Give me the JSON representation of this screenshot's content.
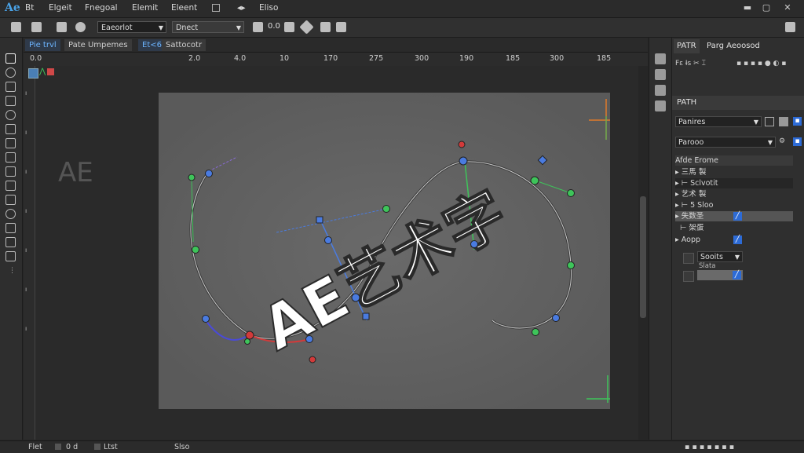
{
  "menubar": {
    "logo": "Ae",
    "items": [
      "Bt",
      "Elgeit",
      "Fnegoal",
      "Elemit",
      "Eleent",
      "Eliso"
    ]
  },
  "toolbar": {
    "dropdown1": "Eaeorlot",
    "dropdown2": "Dnect",
    "value": "0.0"
  },
  "tabs": [
    "Pie trvl",
    "Pate Umpemes",
    "Et<6",
    "Sattocotr"
  ],
  "ruler_h": [
    "0.0",
    "2.0",
    "4.0",
    "10",
    "170",
    "275",
    "300",
    "190",
    "185",
    "300",
    "185"
  ],
  "ghost_text": "AE",
  "art_text": "AE艺术字",
  "status": {
    "left": "Flet",
    "mid": "0 d",
    "right1": "Ltst",
    "right2": "Slso"
  },
  "panel": {
    "tab1": "PATR",
    "tab2": "Parg Aeoosod",
    "section": "PATH",
    "dd1": "Panires",
    "dd2": "Parooo",
    "header": "Afde Erome",
    "rows": [
      "三馬 製",
      "Sclvotit",
      "艺术 製",
      "5 Sloo",
      "失数圣",
      "架蛋",
      "Aopp"
    ],
    "dd3": "Sooits",
    "sub": "Slata"
  },
  "colors": {
    "accent": "#4aa3e8",
    "path": "#3a3a3a",
    "handle_green": "#3ec45a",
    "handle_blue": "#4a7be0",
    "handle_red": "#d23a3a"
  }
}
